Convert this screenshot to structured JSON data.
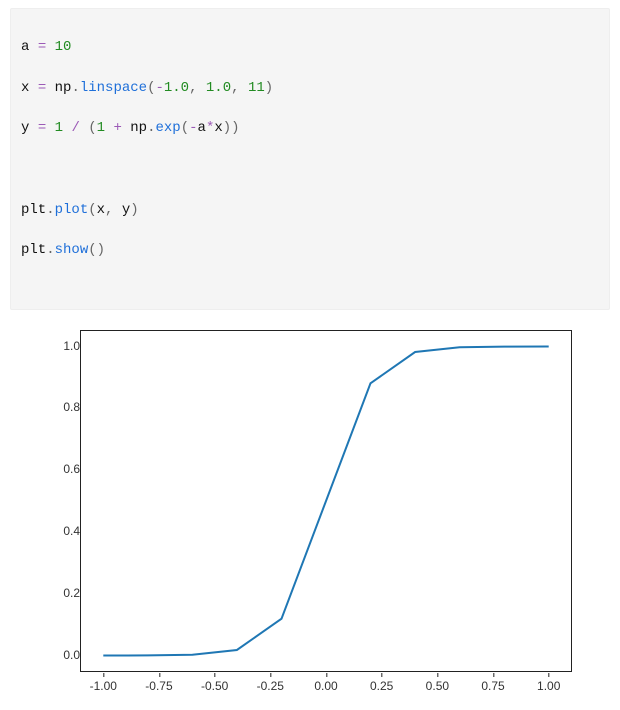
{
  "code": {
    "l1": {
      "v1": "a",
      "op": "=",
      "n1": "10"
    },
    "l2": {
      "v1": "x",
      "op": "=",
      "mod": "np",
      "dot": ".",
      "fn": "linspace",
      "lp": "(",
      "n1": "-1.0",
      "c1": ",",
      "sp": " ",
      "n2": "1.0",
      "c2": ",",
      "n3": "11",
      "rp": ")"
    },
    "l3": {
      "v1": "y",
      "op": "=",
      "n1": "1",
      "div": "/",
      "lp": "(",
      "n2": "1",
      "plus": "+",
      "mod": "np",
      "dot": ".",
      "fn": "exp",
      "lp2": "(",
      "minus": "-",
      "v2": "a",
      "mul": "*",
      "v3": "x",
      "rp2": ")",
      "rp": ")"
    },
    "l5": {
      "mod": "plt",
      "dot": ".",
      "fn": "plot",
      "lp": "(",
      "v1": "x",
      "c1": ",",
      "sp": " ",
      "v2": "y",
      "rp": ")"
    },
    "l6": {
      "mod": "plt",
      "dot": ".",
      "fn": "show",
      "lp": "(",
      "rp": ")"
    }
  },
  "chart_data": {
    "type": "line",
    "x": [
      -1.0,
      -0.8,
      -0.6,
      -0.4,
      -0.2,
      0.0,
      0.2,
      0.4,
      0.6,
      0.8,
      1.0
    ],
    "values": [
      4.54e-05,
      0.000335,
      0.00247,
      0.01799,
      0.1192,
      0.5,
      0.8808,
      0.982,
      0.9975,
      0.99966,
      0.99995
    ],
    "title": "",
    "xlabel": "",
    "ylabel": "",
    "xlim": [
      -1.1,
      1.1
    ],
    "ylim": [
      -0.05,
      1.05
    ],
    "xticks": [
      "-1.00",
      "-0.75",
      "-0.50",
      "-0.25",
      "0.00",
      "0.25",
      "0.50",
      "0.75",
      "1.00"
    ],
    "yticks": [
      "0.0",
      "0.2",
      "0.4",
      "0.6",
      "0.8",
      "1.0"
    ],
    "line_color": "#1f77b4"
  }
}
